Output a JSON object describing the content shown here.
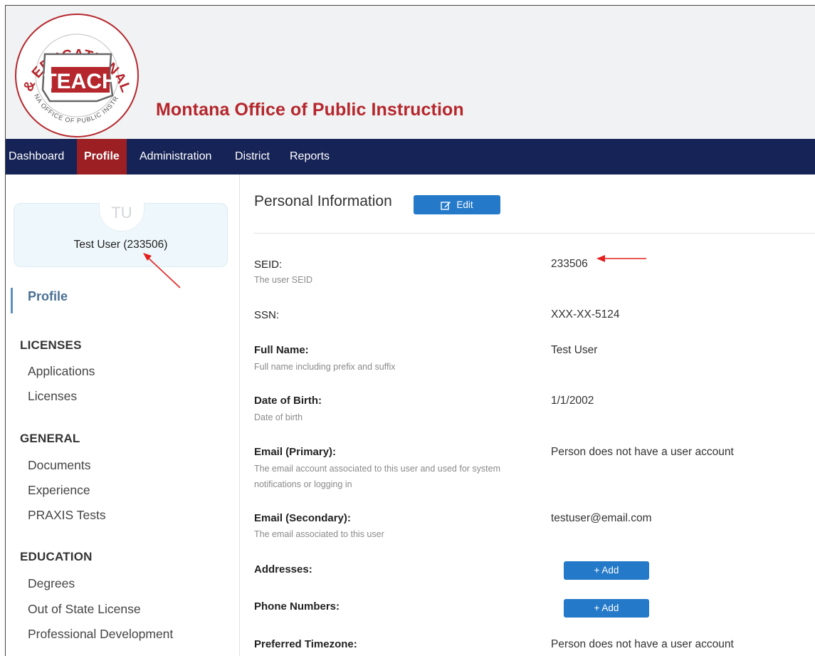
{
  "header": {
    "logo_text": {
      "ring_top": "TEACHER & EDUCATIONAL LEADERS",
      "ring_bottom": "MONTANA OFFICE OF PUBLIC INSTRUCTION",
      "center": "TEACH"
    },
    "org_title": "Montana Office of Public Instruction"
  },
  "nav": {
    "items": [
      {
        "label": "Dashboard",
        "active": false
      },
      {
        "label": "Profile",
        "active": true
      },
      {
        "label": "Administration",
        "active": false
      },
      {
        "label": "District",
        "active": false
      },
      {
        "label": "Reports",
        "active": false
      }
    ]
  },
  "sidebar": {
    "avatar_initials": "TU",
    "user_name": "Test User (233506)",
    "profile_link": "Profile",
    "sections": [
      {
        "title": "LICENSES",
        "items": [
          "Applications",
          "Licenses"
        ]
      },
      {
        "title": "GENERAL",
        "items": [
          "Documents",
          "Experience",
          "PRAXIS Tests"
        ]
      },
      {
        "title": "EDUCATION",
        "items": [
          "Degrees",
          "Out of State License",
          "Professional Development"
        ]
      }
    ]
  },
  "main": {
    "title": "Personal Information",
    "edit_label": "Edit",
    "add_label": "+ Add",
    "fields": [
      {
        "label": "SEID:",
        "help": "The user SEID",
        "value": "233506"
      },
      {
        "label": "SSN:",
        "help": "",
        "value": "XXX-XX-5124"
      },
      {
        "label": "Full Name:",
        "help": "Full name including prefix and suffix",
        "value": "Test User"
      },
      {
        "label": "Date of Birth:",
        "help": "Date of birth",
        "value": "1/1/2002"
      },
      {
        "label": "Email (Primary):",
        "help": "The email account associated to this user and used for system notifications or logging in",
        "value": "Person does not have a user account"
      },
      {
        "label": "Email (Secondary):",
        "help": "The email associated to this user",
        "value": "testuser@email.com"
      },
      {
        "label": "Addresses:",
        "help": "",
        "value": ""
      },
      {
        "label": "Phone Numbers:",
        "help": "",
        "value": ""
      },
      {
        "label": "Preferred Timezone:",
        "help": "",
        "value": "Person does not have a user account"
      }
    ]
  },
  "colors": {
    "brand_red": "#b5272d",
    "nav_bg": "#162356",
    "nav_active": "#9c1f23",
    "button_blue": "#2479c9",
    "annotation_arrow": "#e4201e"
  }
}
